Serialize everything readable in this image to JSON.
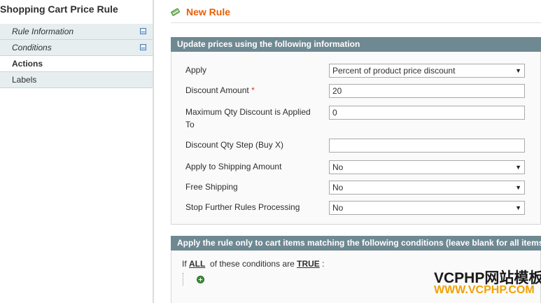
{
  "sidebar": {
    "title": "Shopping Cart Price Rule",
    "tabs": [
      {
        "label": "Rule Information"
      },
      {
        "label": "Conditions"
      },
      {
        "label": "Actions"
      },
      {
        "label": "Labels"
      }
    ]
  },
  "header": {
    "title": "New Rule"
  },
  "actions_section": {
    "title": "Update prices using the following information",
    "fields": [
      {
        "label": "Apply",
        "value": "Percent of product price discount",
        "type": "select"
      },
      {
        "label": "Discount Amount",
        "required_mark": "*",
        "value": "20",
        "type": "text"
      },
      {
        "label_line1": "Maximum Qty Discount is Applied",
        "label_line2": "To",
        "value": "0",
        "type": "text"
      },
      {
        "label": "Discount Qty Step (Buy X)",
        "value": "",
        "type": "text"
      },
      {
        "label": "Apply to Shipping Amount",
        "value": "No",
        "type": "select"
      },
      {
        "label": "Free Shipping",
        "value": "No",
        "type": "select"
      },
      {
        "label": "Stop Further Rules Processing",
        "value": "No",
        "type": "select"
      }
    ]
  },
  "conditions_section": {
    "title": "Apply the rule only to cart items matching the following conditions (leave blank for all items)",
    "prefix": "If",
    "aggregator": "ALL",
    "middle": "of these conditions are",
    "value": "TRUE",
    "suffix": ":"
  },
  "watermark": {
    "line1": "VCPHP网站模板",
    "line2": "WWW.VCPHP.COM"
  },
  "icons": {
    "tab_changed": "save-disk-icon",
    "page": "pencil-icon",
    "add_condition": "plus-circle-icon"
  }
}
